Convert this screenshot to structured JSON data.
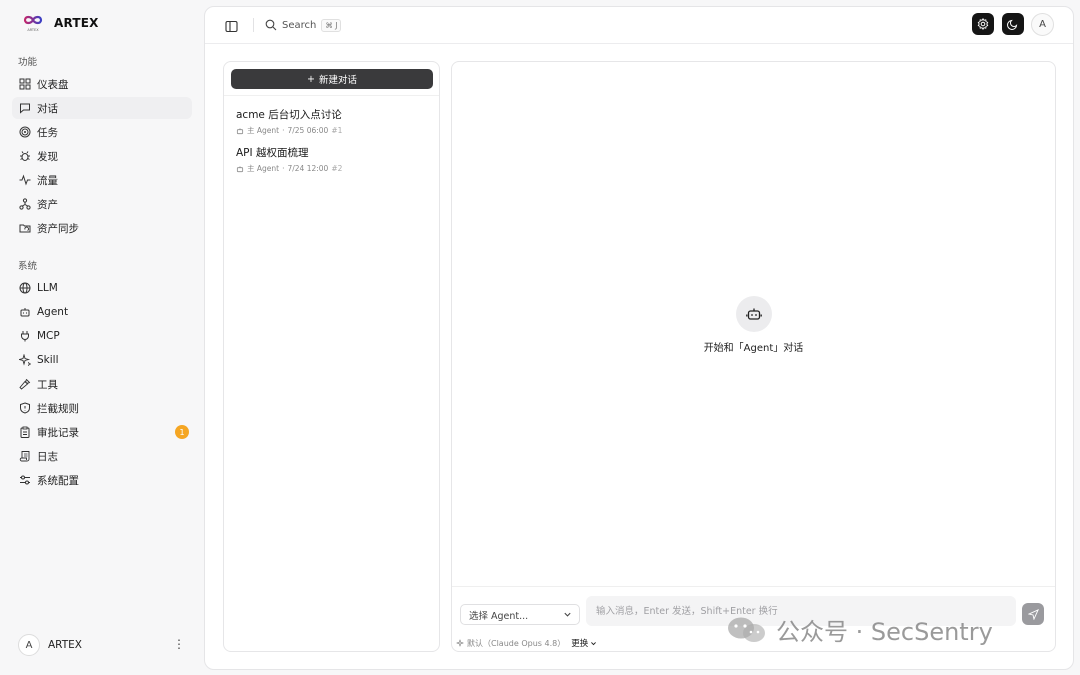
{
  "brand": {
    "name": "ARTEX",
    "logo_text": "ARTEX"
  },
  "sidebar": {
    "section_features": "功能",
    "features": [
      {
        "label": "仪表盘",
        "icon": "dashboard-icon"
      },
      {
        "label": "对话",
        "icon": "chat-icon",
        "active": true
      },
      {
        "label": "任务",
        "icon": "target-icon"
      },
      {
        "label": "发现",
        "icon": "bug-icon"
      },
      {
        "label": "流量",
        "icon": "activity-icon"
      },
      {
        "label": "资产",
        "icon": "network-icon"
      },
      {
        "label": "资产同步",
        "icon": "folder-sync-icon"
      }
    ],
    "section_system": "系统",
    "system": [
      {
        "label": "LLM",
        "icon": "globe-icon"
      },
      {
        "label": "Agent",
        "icon": "bot-icon"
      },
      {
        "label": "MCP",
        "icon": "plug-icon"
      },
      {
        "label": "Skill",
        "icon": "sparkles-icon"
      },
      {
        "label": "工具",
        "icon": "wrench-icon"
      },
      {
        "label": "拦截规则",
        "icon": "shield-icon"
      },
      {
        "label": "审批记录",
        "icon": "clipboard-icon",
        "badge": "1"
      },
      {
        "label": "日志",
        "icon": "scroll-icon"
      },
      {
        "label": "系统配置",
        "icon": "sliders-icon"
      }
    ],
    "user": {
      "avatar": "A",
      "name": "ARTEX",
      "more": "⋮"
    }
  },
  "topbar": {
    "search_label": "Search",
    "search_shortcut": "⌘ J",
    "avatar": "A"
  },
  "conversations": {
    "new_label": "新建对话",
    "items": [
      {
        "title": "acme 后台切入点讨论",
        "agent": "主 Agent",
        "time": "7/25 06:00",
        "num": "#1"
      },
      {
        "title": "API 越权面梳理",
        "agent": "主 Agent",
        "time": "7/24 12:00",
        "num": "#2"
      }
    ]
  },
  "chat": {
    "empty_text": "开始和「Agent」对话",
    "agent_placeholder": "选择 Agent...",
    "input_placeholder": "输入消息，Enter 发送，Shift+Enter 换行",
    "model_prefix": "默认（Claude Opus 4.8）",
    "model_change": "更换"
  },
  "watermark": {
    "text": "公众号 · SecSentry"
  },
  "colors": {
    "badge": "#f5a623",
    "dark_button": "#151515",
    "new_button": "#3a3a3c"
  }
}
